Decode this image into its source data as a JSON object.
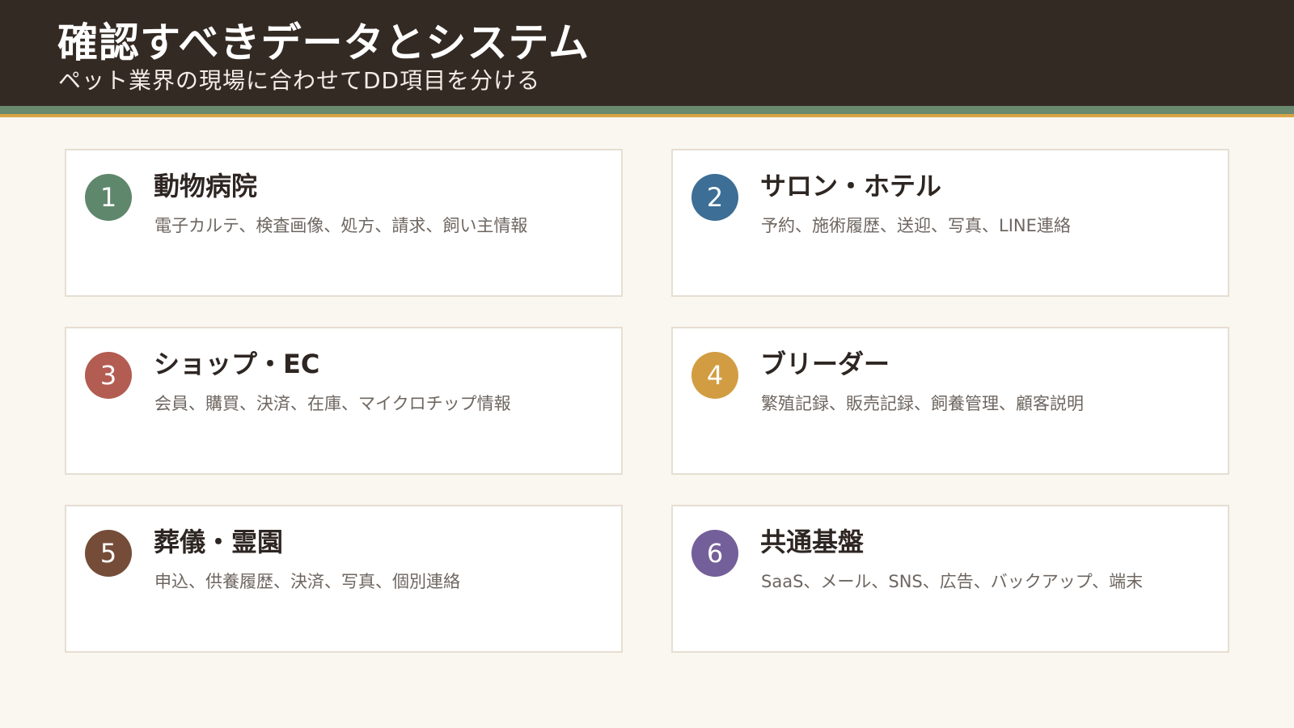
{
  "header": {
    "title": "確認すべきデータとシステム",
    "subtitle": "ペット業界の現場に合わせてDD項目を分ける"
  },
  "colors": {
    "header_bg": "#342a24",
    "stripe_green": "#6a8a70",
    "stripe_gold": "#d9a445",
    "page_bg": "#faf7f1"
  },
  "cards": [
    {
      "number": "1",
      "title": "動物病院",
      "description": "電子カルテ、検査画像、処方、請求、飼い主情報",
      "color": "#5f876c"
    },
    {
      "number": "2",
      "title": "サロン・ホテル",
      "description": "予約、施術履歴、送迎、写真、LINE連絡",
      "color": "#3d6e95"
    },
    {
      "number": "3",
      "title": "ショップ・EC",
      "description": "会員、購買、決済、在庫、マイクロチップ情報",
      "color": "#b35c52"
    },
    {
      "number": "4",
      "title": "ブリーダー",
      "description": "繁殖記録、販売記録、飼養管理、顧客説明",
      "color": "#d29d42"
    },
    {
      "number": "5",
      "title": "葬儀・霊園",
      "description": "申込、供養履歴、決済、写真、個別連絡",
      "color": "#744c38"
    },
    {
      "number": "6",
      "title": "共通基盤",
      "description": "SaaS、メール、SNS、広告、バックアップ、端末",
      "color": "#735f99"
    }
  ]
}
